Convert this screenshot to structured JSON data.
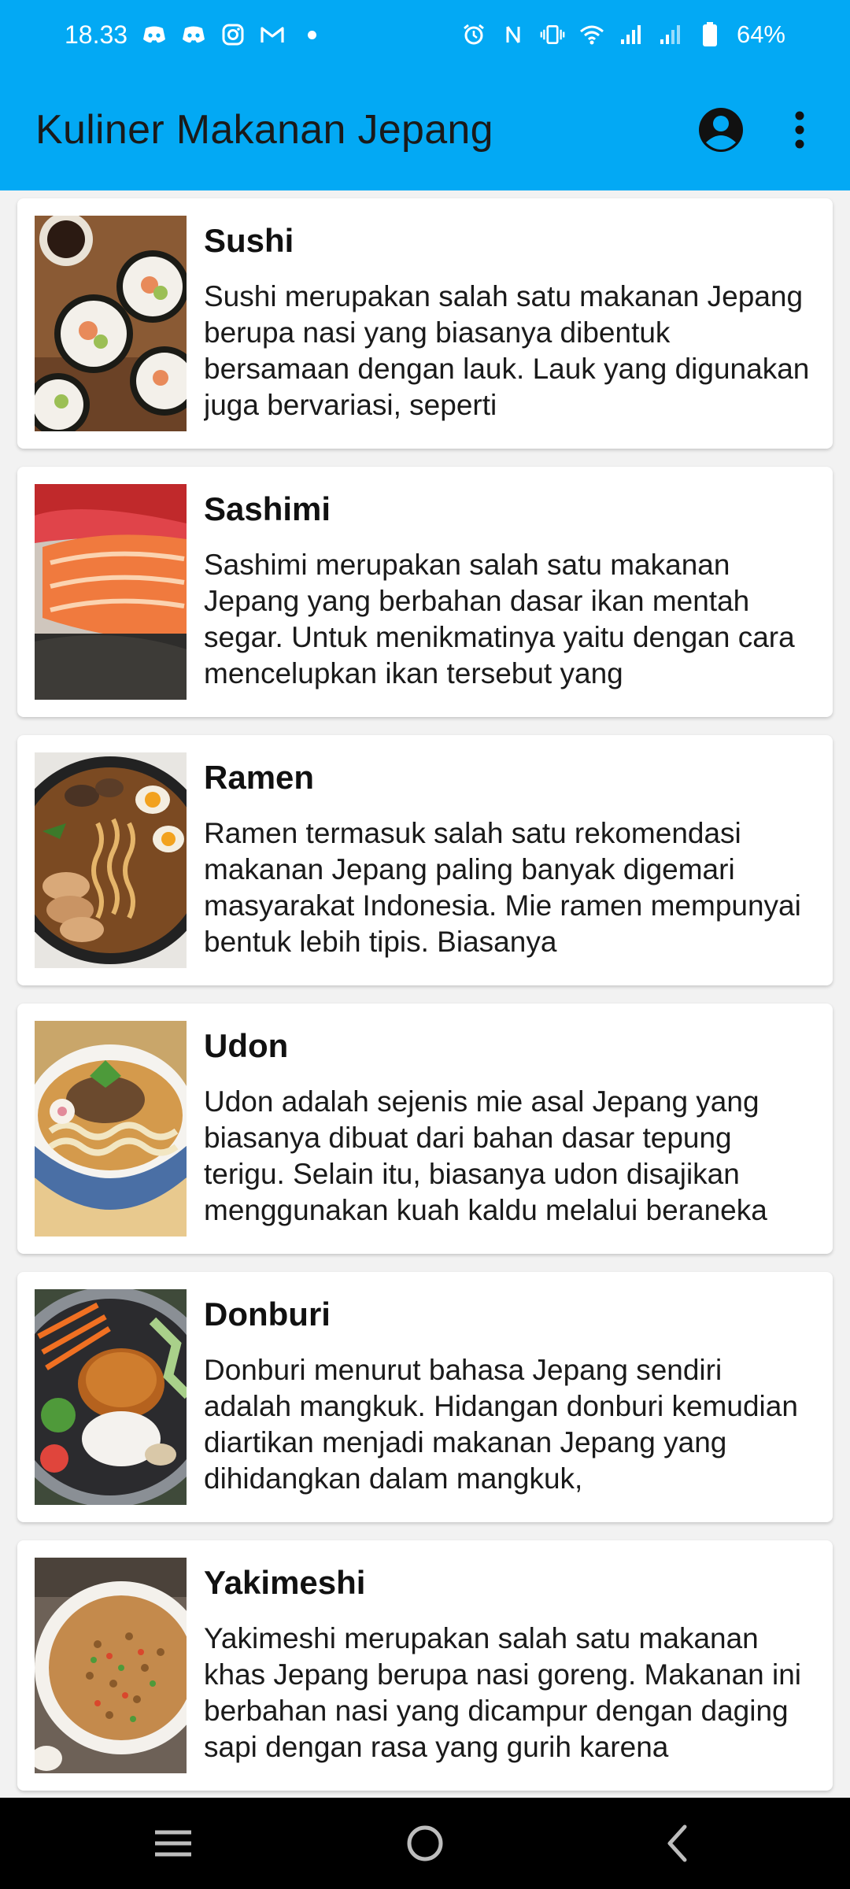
{
  "status_bar": {
    "time": "18.33",
    "battery": "64%",
    "left_icons": [
      "discord-icon",
      "discord-icon",
      "instagram-icon",
      "gmail-icon",
      "dot-icon"
    ],
    "right_icons": [
      "alarm-icon",
      "nfc-icon",
      "vibrate-icon",
      "wifi-icon",
      "signal-icon",
      "signal-icon",
      "battery-icon"
    ]
  },
  "app_bar": {
    "title": "Kuliner Makanan Jepang",
    "background": "#03a9f4"
  },
  "items": [
    {
      "title": "Sushi",
      "description": "Sushi merupakan salah satu makanan Jepang berupa nasi yang biasanya dibentuk bersamaan dengan lauk. Lauk yang digunakan juga bervariasi, seperti"
    },
    {
      "title": "Sashimi",
      "description": "Sashimi merupakan salah satu makanan Jepang yang berbahan dasar ikan mentah segar. Untuk menikmatinya yaitu dengan cara mencelupkan ikan tersebut yang"
    },
    {
      "title": "Ramen",
      "description": "Ramen termasuk salah satu rekomendasi makanan Jepang paling banyak digemari masyarakat Indonesia. Mie ramen mempunyai bentuk lebih tipis. Biasanya"
    },
    {
      "title": "Udon",
      "description": "Udon adalah sejenis mie asal Jepang yang biasanya dibuat dari bahan dasar tepung terigu. Selain itu, biasanya udon disajikan menggunakan kuah kaldu melalui beraneka"
    },
    {
      "title": "Donburi",
      "description": "Donburi menurut bahasa Jepang sendiri adalah mangkuk. Hidangan donburi kemudian diartikan menjadi makanan Jepang yang dihidangkan dalam mangkuk,"
    },
    {
      "title": "Yakimeshi",
      "description": "Yakimeshi merupakan salah satu makanan khas Jepang berupa nasi goreng. Makanan ini berbahan nasi yang dicampur dengan daging sapi dengan rasa yang gurih karena"
    }
  ]
}
